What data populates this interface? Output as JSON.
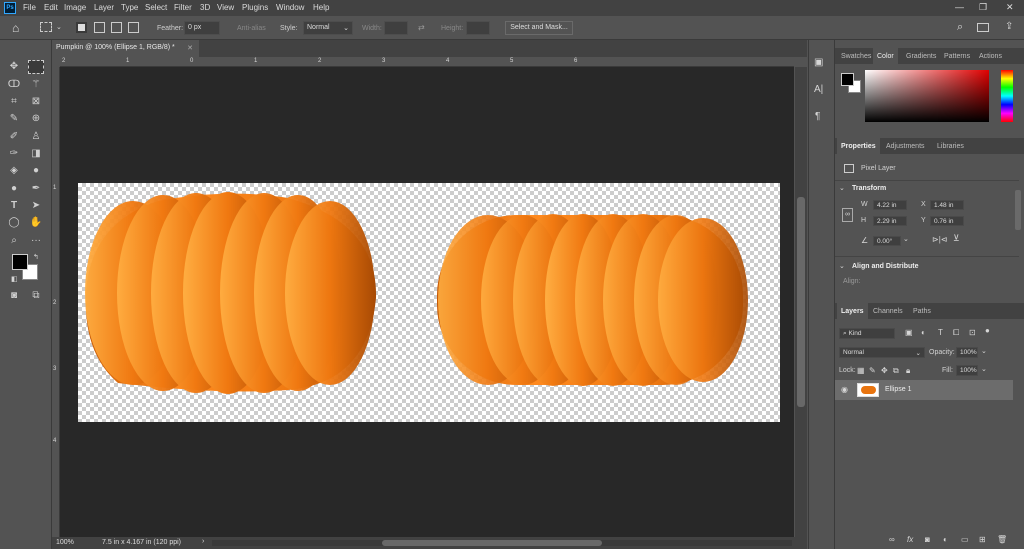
{
  "app": {
    "logo": "Ps"
  },
  "menu": [
    "File",
    "Edit",
    "Image",
    "Layer",
    "Type",
    "Select",
    "Filter",
    "3D",
    "View",
    "Plugins",
    "Window",
    "Help"
  ],
  "options_bar": {
    "feather_label": "Feather:",
    "feather_value": "0 px",
    "anti_alias_label": "Anti-alias",
    "style_label": "Style:",
    "style_value": "Normal",
    "width_label": "Width:",
    "height_label": "Height:",
    "select_mask_label": "Select and Mask..."
  },
  "document": {
    "tab_title": "Pumpkin @ 100% (Ellipse 1, RGB/8) *",
    "zoom": "100%",
    "doc_info": "7.5 in x 4.167 in (120 ppi)"
  },
  "rulers": {
    "h_ticks": [
      "2",
      "1",
      "0",
      "1",
      "2",
      "3",
      "4",
      "5",
      "6"
    ],
    "v_ticks": [
      "1",
      "2",
      "3",
      "4"
    ]
  },
  "color_panel": {
    "tabs": [
      "Swatches",
      "Color",
      "Gradients",
      "Patterns",
      "Actions"
    ],
    "active": "Color"
  },
  "properties": {
    "tabs": [
      "Properties",
      "Adjustments",
      "Libraries"
    ],
    "active": "Properties",
    "layer_type": "Pixel Layer",
    "transform_header": "Transform",
    "w_label": "W",
    "w_value": "4.22 in",
    "x_label": "X",
    "x_value": "1.48 in",
    "h_label": "H",
    "h_value": "2.29 in",
    "y_label": "Y",
    "y_value": "0.76 in",
    "angle_value": "0.00°",
    "align_header": "Align and Distribute",
    "align_label": "Align:"
  },
  "layers_panel": {
    "tabs": [
      "Layers",
      "Channels",
      "Paths"
    ],
    "active": "Layers",
    "filter_kind": "Kind",
    "blend_mode": "Normal",
    "opacity_label": "Opacity:",
    "opacity_value": "100%",
    "lock_label": "Lock:",
    "fill_label": "Fill:",
    "fill_value": "100%",
    "layers": [
      {
        "name": "Ellipse 1"
      }
    ]
  },
  "colors": {
    "accent": "#e8740f",
    "foreground": "#000000",
    "background": "#ffffff"
  }
}
